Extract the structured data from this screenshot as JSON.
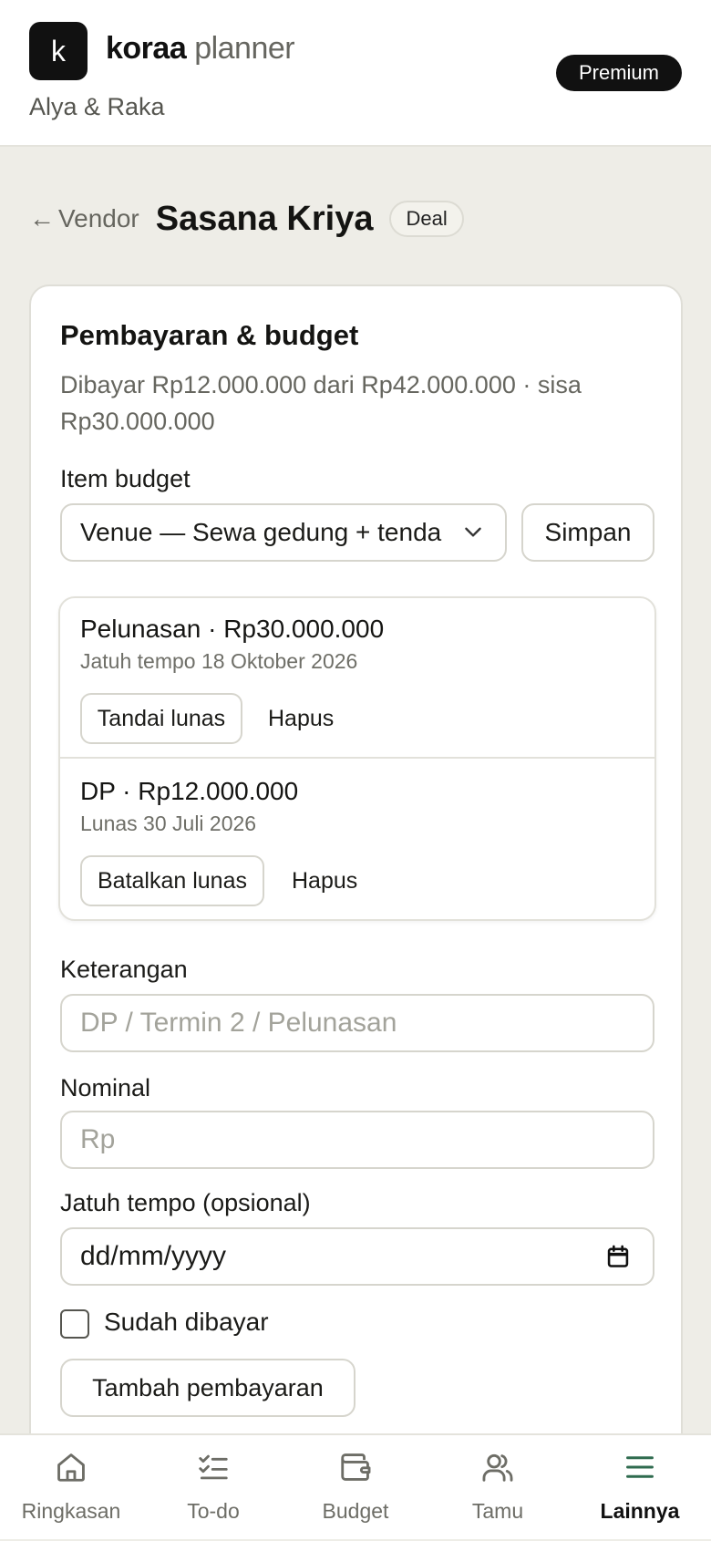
{
  "header": {
    "logo_letter": "k",
    "brand_bold": "koraa",
    "brand_light": "planner",
    "couple": "Alya & Raka",
    "plan_badge": "Premium"
  },
  "breadcrumb": {
    "back_arrow": "←",
    "back_label": "Vendor",
    "vendor_name": "Sasana Kriya",
    "status": "Deal"
  },
  "payment": {
    "title": "Pembayaran & budget",
    "summary": "Dibayar Rp12.000.000 dari Rp42.000.000 · sisa Rp30.000.000",
    "budget_item_label": "Item budget",
    "budget_item_value": "Venue — Sewa gedung + tenda",
    "save_label": "Simpan",
    "items": [
      {
        "title": "Pelunasan · Rp30.000.000",
        "date": "Jatuh tempo 18 Oktober 2026",
        "action": "Tandai lunas",
        "delete": "Hapus"
      },
      {
        "title": "DP · Rp12.000.000",
        "date": "Lunas 30 Juli 2026",
        "action": "Batalkan lunas",
        "delete": "Hapus"
      }
    ],
    "form": {
      "desc_label": "Keterangan",
      "desc_placeholder": "DP / Termin 2 / Pelunasan",
      "amount_label": "Nominal",
      "amount_placeholder": "Rp",
      "due_label": "Jatuh tempo (opsional)",
      "due_placeholder": "dd/mm/yyyy",
      "paid_label": "Sudah dibayar",
      "paid_checked": false,
      "add_label": "Tambah pembayaran"
    }
  },
  "tabbar": {
    "tabs": [
      {
        "label": "Ringkasan",
        "icon": "home-icon"
      },
      {
        "label": "To-do",
        "icon": "checklist-icon"
      },
      {
        "label": "Budget",
        "icon": "wallet-icon"
      },
      {
        "label": "Tamu",
        "icon": "users-icon"
      },
      {
        "label": "Lainnya",
        "icon": "menu-icon"
      }
    ],
    "active": "Lainnya",
    "active_color": "#2f6b4f"
  }
}
